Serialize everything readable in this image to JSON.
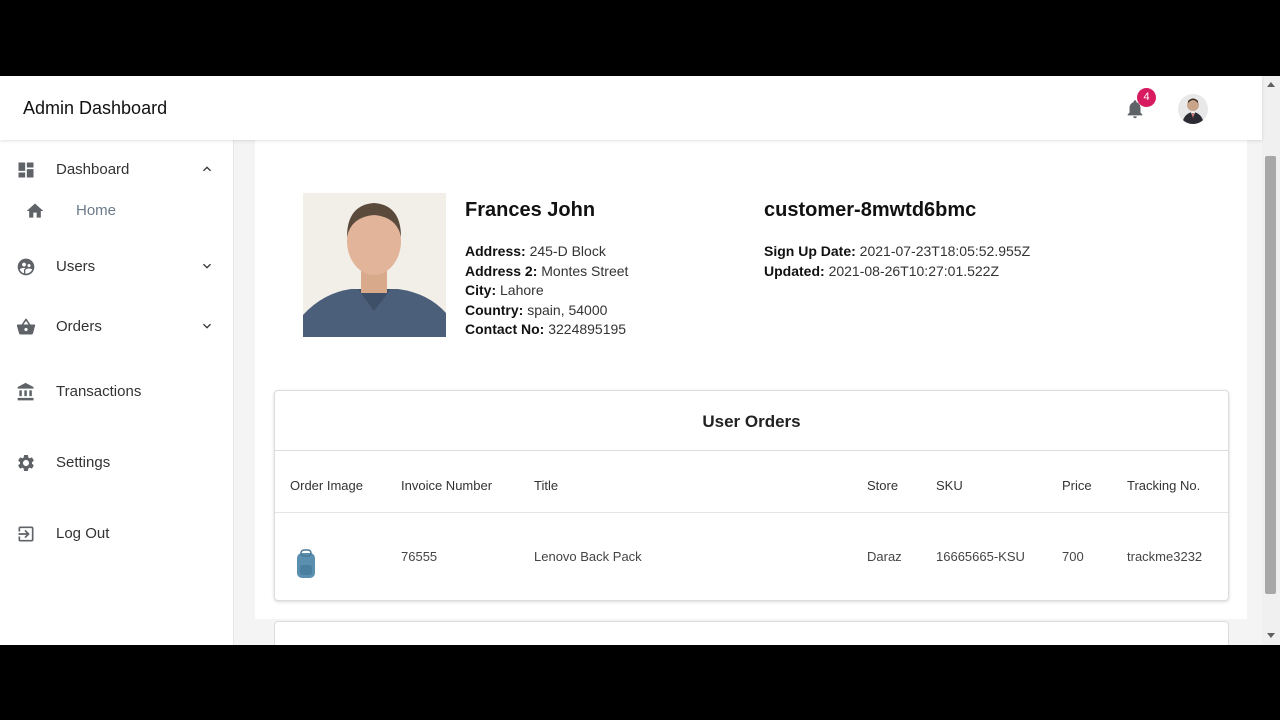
{
  "app": {
    "title": "Admin Dashboard",
    "notification_count": "4"
  },
  "sidebar": {
    "items": [
      {
        "label": "Dashboard",
        "icon": "dashboard-icon"
      },
      {
        "label": "Home",
        "icon": "home-icon"
      },
      {
        "label": "Users",
        "icon": "users-icon"
      },
      {
        "label": "Orders",
        "icon": "basket-icon"
      },
      {
        "label": "Transactions",
        "icon": "bank-icon"
      },
      {
        "label": "Settings",
        "icon": "gear-icon"
      },
      {
        "label": "Log Out",
        "icon": "logout-icon"
      }
    ]
  },
  "profile": {
    "name": "Frances John",
    "address_label": "Address:",
    "address": "245-D Block",
    "address2_label": "Address 2:",
    "address2": "Montes Street",
    "city_label": "City:",
    "city": "Lahore",
    "country_label": "Country:",
    "country": "spain, 54000",
    "contact_label": "Contact No:",
    "contact": "3224895195",
    "customer_id": "customer-8mwtd6bmc",
    "signup_label": "Sign Up Date:",
    "signup": "2021-07-23T18:05:52.955Z",
    "updated_label": "Updated:",
    "updated": "2021-08-26T10:27:01.522Z"
  },
  "orders": {
    "title": "User Orders",
    "columns": [
      "Order Image",
      "Invoice Number",
      "Title",
      "Store",
      "SKU",
      "Price",
      "Tracking No."
    ],
    "rows": [
      {
        "invoice": "76555",
        "title": "Lenovo Back Pack",
        "store": "Daraz",
        "sku": "16665665-KSU",
        "price": "700",
        "tracking": "trackme3232"
      }
    ]
  },
  "colors": {
    "badge": "#d81b60",
    "icon": "#5f6368"
  }
}
